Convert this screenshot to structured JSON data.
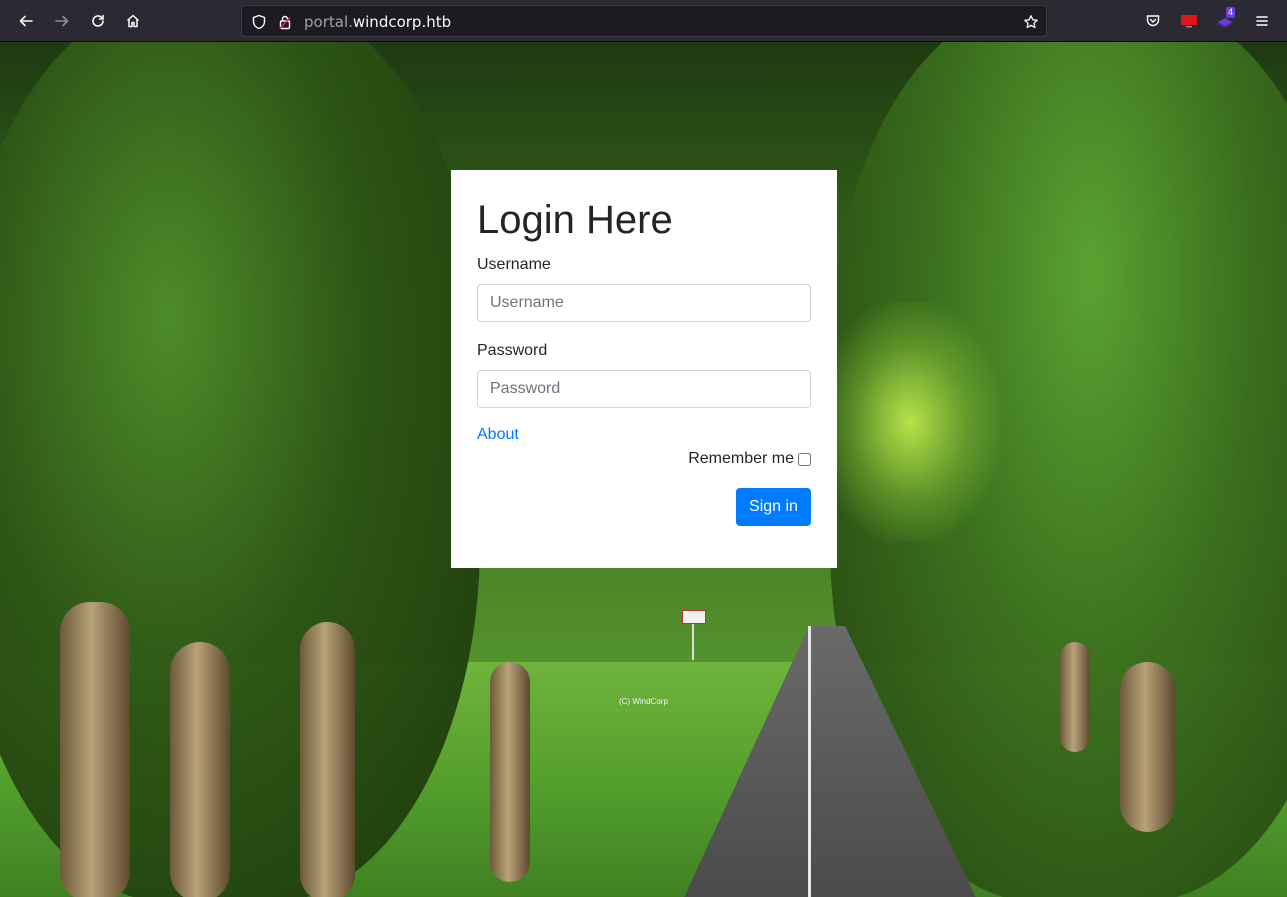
{
  "browser": {
    "url_subdomain": "portal.",
    "url_domain": "windcorp.htb",
    "extension_badge": "4"
  },
  "page": {
    "copyright": "(C) WindCorp"
  },
  "login": {
    "title": "Login Here",
    "username_label": "Username",
    "username_placeholder": "Username",
    "password_label": "Password",
    "password_placeholder": "Password",
    "about_link": "About",
    "remember_label": "Remember me",
    "signin_label": "Sign in"
  },
  "colors": {
    "primary": "#007bff",
    "toolbar": "#2b2a33"
  }
}
